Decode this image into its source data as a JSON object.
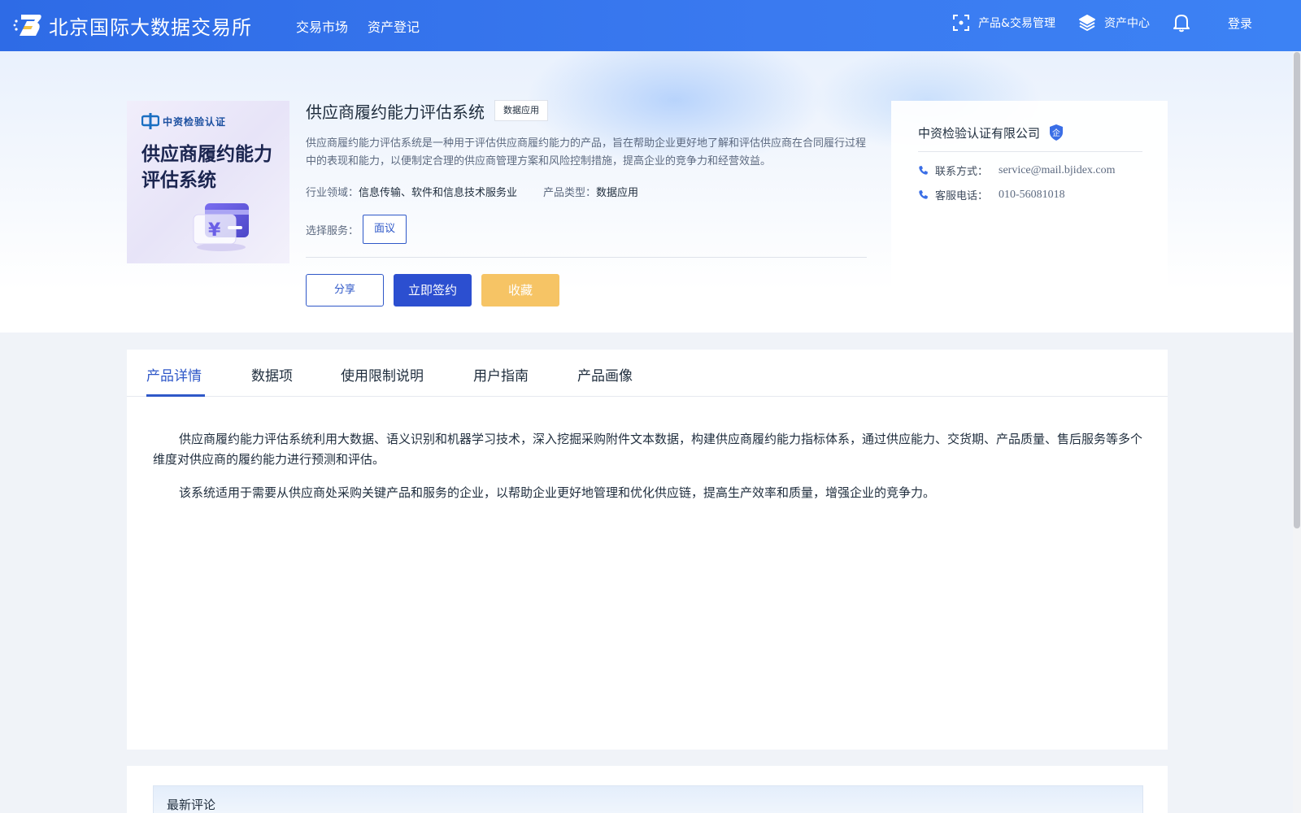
{
  "header": {
    "site_name": "北京国际大数据交易所",
    "nav": [
      "交易市场",
      "资产登记"
    ],
    "product_mgmt": "产品&交易管理",
    "asset_center": "资产中心",
    "login": "登录"
  },
  "product": {
    "cover_brand": "中资检验认证",
    "cover_title": "供应商履约能力评估系统",
    "title": "供应商履约能力评估系统",
    "type_tag": "数据应用",
    "description": "供应商履约能力评估系统是一种用于评估供应商履约能力的产品，旨在帮助企业更好地了解和评估供应商在合同履行过程中的表现和能力，以便制定合理的供应商管理方案和风险控制措施，提高企业的竞争力和经营效益。",
    "industry_label": "行业领域：",
    "industry_value": "信息传输、软件和信息技术服务业",
    "ptype_label": "产品类型：",
    "ptype_value": "数据应用",
    "service_label": "选择服务：",
    "service_option": "面议",
    "share": "分享",
    "sign": "立即签约",
    "favorite": "收藏"
  },
  "company": {
    "name": "中资检验认证有限公司",
    "badge": "企",
    "contact_label": "联系方式：",
    "contact_value": "service@mail.bjidex.com",
    "phone_label": "客服电话：",
    "phone_value": "010-56081018"
  },
  "tabs": [
    "产品详情",
    "数据项",
    "使用限制说明",
    "用户指南",
    "产品画像"
  ],
  "detail": {
    "para1": "供应商履约能力评估系统利用大数据、语义识别和机器学习技术，深入挖掘采购附件文本数据，构建供应商履约能力指标体系，通过供应能力、交货期、产品质量、售后服务等多个维度对供应商的履约能力进行预测和评估。",
    "para2": "该系统适用于需要从供应商处采购关键产品和服务的企业，以帮助企业更好地管理和优化供应链，提高生产效率和质量，增强企业的竞争力。"
  },
  "comments": {
    "title": "最新评论"
  },
  "colors": {
    "header": "#2e6be6",
    "primary": "#2c4fd0",
    "favorite": "#f6c465"
  }
}
